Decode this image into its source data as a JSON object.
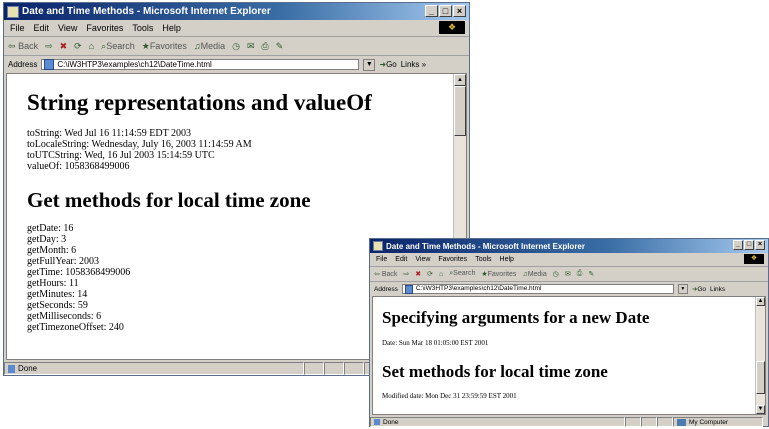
{
  "window1": {
    "title": "Date and Time Methods - Microsoft Internet Explorer",
    "menu": [
      "File",
      "Edit",
      "View",
      "Favorites",
      "Tools",
      "Help"
    ],
    "toolbar": {
      "back": "Back",
      "search": "Search",
      "favorites": "Favorites",
      "media": "Media"
    },
    "address": {
      "label": "Address",
      "url": "C:\\iW3HTP3\\examples\\ch12\\DateTime.html",
      "go": "Go",
      "links": "Links »"
    },
    "heading1": "String representations and valueOf",
    "string_lines": [
      "toString: Wed Jul 16 11:14:59 EDT 2003",
      "toLocaleString: Wednesday, July 16, 2003 11:14:59 AM",
      "toUTCString: Wed, 16 Jul 2003 15:14:59 UTC",
      "valueOf: 1058368499006"
    ],
    "heading2": "Get methods for local time zone",
    "get_lines": [
      "getDate: 16",
      "getDay: 3",
      "getMonth: 6",
      "getFullYear: 2003",
      "getTime: 1058368499006",
      "getHours: 11",
      "getMinutes: 14",
      "getSeconds: 59",
      "getMilliseconds: 6",
      "getTimezoneOffset: 240"
    ],
    "status": "Done"
  },
  "window2": {
    "title": "Date and Time Methods - Microsoft Internet Explorer",
    "menu": [
      "File",
      "Edit",
      "View",
      "Favorites",
      "Tools",
      "Help"
    ],
    "toolbar": {
      "back": "Back",
      "search": "Search",
      "favorites": "Favorites",
      "media": "Media"
    },
    "address": {
      "label": "Address",
      "url": "C:\\iW3HTP3\\examples\\ch12\\DateTime.html",
      "go": "Go",
      "links": "Links"
    },
    "heading1": "Specifying arguments for a new Date",
    "date_line": "Date: Sun Mar 18 01:05:00 EST 2001",
    "heading2": "Set methods for local time zone",
    "modified_line": "Modified date: Mon Dec 31 23:59:59 EST 2001",
    "status": "Done",
    "zone": "My Computer"
  }
}
